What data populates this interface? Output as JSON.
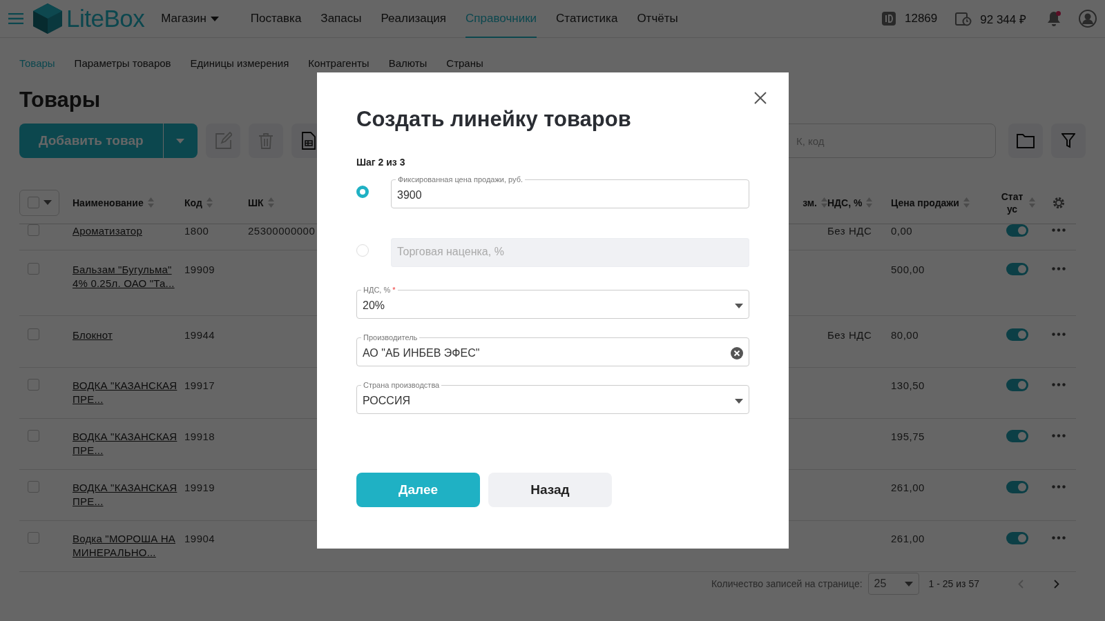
{
  "topbar": {
    "brand": "LiteBox",
    "store": "Магазин",
    "nav": [
      {
        "label": "Поставка",
        "selected": false
      },
      {
        "label": "Запасы",
        "selected": false
      },
      {
        "label": "Реализация",
        "selected": false
      },
      {
        "label": "Справочники",
        "selected": true
      },
      {
        "label": "Статистика",
        "selected": false
      },
      {
        "label": "Отчёты",
        "selected": false
      }
    ],
    "account_id": "12869",
    "balance": "92 344 ₽",
    "has_unread": true
  },
  "subnav": [
    {
      "label": "Товары",
      "selected": true
    },
    {
      "label": "Параметры товаров",
      "selected": false
    },
    {
      "label": "Единицы измерения",
      "selected": false
    },
    {
      "label": "Контрагенты",
      "selected": false
    },
    {
      "label": "Валюты",
      "selected": false
    },
    {
      "label": "Страны",
      "selected": false
    }
  ],
  "page_title": "Товары",
  "toolbar": {
    "add_button": "Добавить товар",
    "search_placeholder": "К, код"
  },
  "table": {
    "columns": [
      "Наименование",
      "Код",
      "ШК",
      "зм.",
      "НДС, %",
      "Цена продажи",
      "Статус"
    ],
    "all_checked": false,
    "rows": [
      {
        "name": "Ароматизатор",
        "code": "1800",
        "barcode": "25300000000",
        "vat": "Без НДС",
        "price": "0,00",
        "checked": false,
        "on": true
      },
      {
        "name": "Бальзам \"Бугульма\" 4% 0.25л. ОАО \"Та...",
        "code": "19909",
        "price": "500,00",
        "checked": false,
        "on": true
      },
      {
        "name": "Блокнот",
        "code": "19944",
        "vat": "Без НДС",
        "price": "80,00",
        "checked": false,
        "on": true
      },
      {
        "name": "ВОДКА \"КАЗАНСКАЯ ПРЕ...",
        "code": "19917",
        "price": "130,50",
        "checked": false,
        "on": true
      },
      {
        "name": "ВОДКА \"КАЗАНСКАЯ ПРЕ...",
        "code": "19918",
        "price": "195,75",
        "checked": false,
        "on": true
      },
      {
        "name": "ВОДКА \"КАЗАНСКАЯ ПРЕ...",
        "code": "19919",
        "price": "261,00",
        "checked": false,
        "on": true
      },
      {
        "name": "Водка \"МОРОША НА МИНЕРАЛЬНО...",
        "code": "19904",
        "price": "261,00",
        "checked": false,
        "on": true
      }
    ]
  },
  "pagination": {
    "per_page_label": "Количество записей на странице:",
    "per_page": "25",
    "range": "1 - 25 из 57"
  },
  "modal": {
    "title": "Создать линейку товаров",
    "step": "Шаг 2 из 3",
    "price_options": [
      {
        "label": "Фиксированная цена продажи, руб.",
        "value": "3900",
        "selected": true,
        "disabled": false
      },
      {
        "placeholder": "Торговая наценка, %",
        "selected": false,
        "disabled": true
      }
    ],
    "fields": [
      {
        "kind": "select",
        "label": "НДС, %",
        "required_mark": "*",
        "value": "20%"
      },
      {
        "kind": "clearable",
        "label": "Производитель",
        "value": "АО \"АБ ИНБЕВ ЭФЕС\""
      },
      {
        "kind": "select",
        "label": "Страна производства",
        "value": "РОССИЯ"
      }
    ],
    "buttons": [
      {
        "label": "Далее",
        "primary": true
      },
      {
        "label": "Назад",
        "primary": false
      }
    ]
  }
}
